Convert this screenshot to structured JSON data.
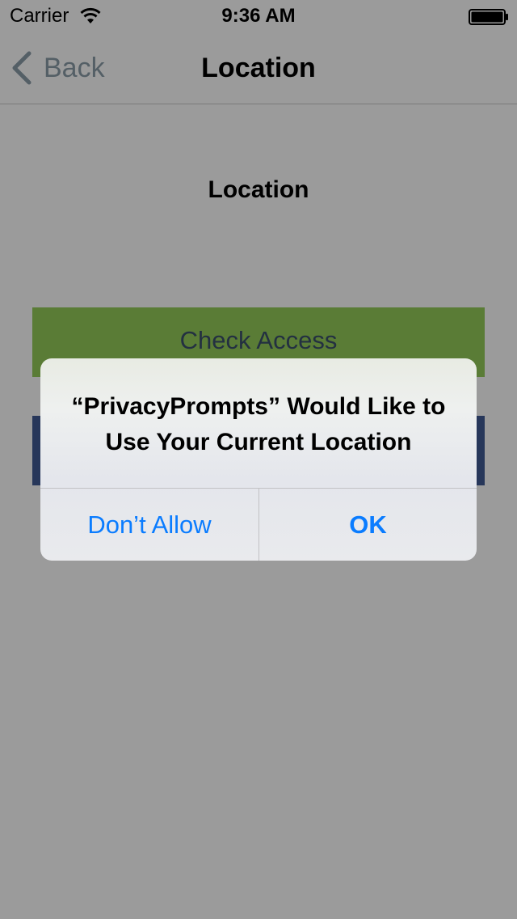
{
  "status_bar": {
    "carrier": "Carrier",
    "time": "9:36 AM",
    "wifi_icon": "wifi-icon",
    "battery_icon": "battery-icon"
  },
  "nav_bar": {
    "back_label": "Back",
    "back_icon": "chevron-left-icon",
    "title": "Location"
  },
  "content": {
    "title": "Location",
    "check_access_label": "Check Access"
  },
  "alert": {
    "message": "“PrivacyPrompts” Would Like to Use Your Current Location",
    "dont_allow_label": "Don’t Allow",
    "ok_label": "OK"
  },
  "colors": {
    "background_dimmed": "#9b9b9b",
    "check_access_button": "#5a7c36",
    "second_button": "#27375a",
    "alert_button_text": "#0a7cff",
    "back_button_text": "#545f66"
  }
}
